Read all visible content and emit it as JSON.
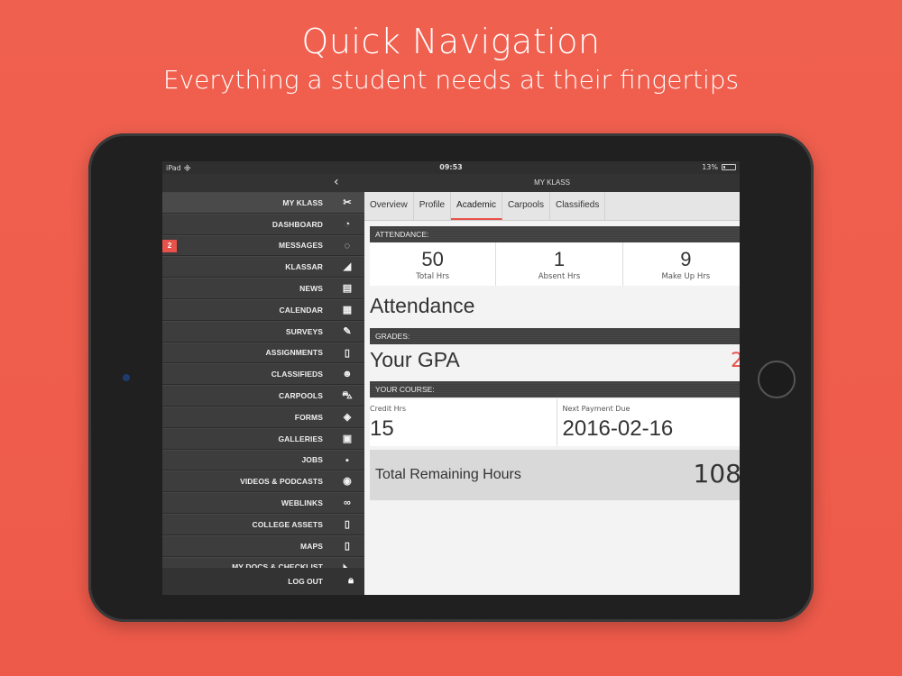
{
  "headline": {
    "title": "Quick Navigation",
    "subtitle": "Everything a student needs at their fingertips"
  },
  "status_bar": {
    "device": "iPad",
    "time": "09:53",
    "battery": "13%"
  },
  "screen_title": "MY KLASS",
  "sidebar": {
    "items": [
      {
        "label": "MY KLASS",
        "icon": "tools-icon"
      },
      {
        "label": "DASHBOARD",
        "icon": "gauge-icon"
      },
      {
        "label": "MESSAGES",
        "icon": "chat-icon",
        "badge": "2"
      },
      {
        "label": "KlassAR",
        "icon": "ar-icon"
      },
      {
        "label": "NEWS",
        "icon": "newspaper-icon"
      },
      {
        "label": "CALENDAR",
        "icon": "calendar-icon"
      },
      {
        "label": "SURVEYS",
        "icon": "pencil-icon"
      },
      {
        "label": "ASSIGNMENTS",
        "icon": "document-icon"
      },
      {
        "label": "CLASSIFIEDS",
        "icon": "people-icon"
      },
      {
        "label": "CARPOOLS",
        "icon": "car-icon"
      },
      {
        "label": "FORMS",
        "icon": "layers-icon"
      },
      {
        "label": "GALLERIES",
        "icon": "gallery-icon"
      },
      {
        "label": "JOBS",
        "icon": "briefcase-icon"
      },
      {
        "label": "VIDEOS & PODCASTS",
        "icon": "play-icon"
      },
      {
        "label": "WEBLINKS",
        "icon": "link-icon"
      },
      {
        "label": "COLLEGE ASSETS",
        "icon": "file-icon"
      },
      {
        "label": "MAPS",
        "icon": "map-icon"
      },
      {
        "label": "MY DOCS & CHECKLIST",
        "icon": "doc-check-icon"
      }
    ],
    "logout_label": "LOG OUT"
  },
  "tabs": [
    "Overview",
    "Profile",
    "Academic",
    "Carpools",
    "Classifieds"
  ],
  "active_tab": "Academic",
  "attendance": {
    "section_label": "ATTENDANCE:",
    "stats": [
      {
        "value": "50",
        "label": "Total Hrs"
      },
      {
        "value": "1",
        "label": "Absent Hrs"
      },
      {
        "value": "9",
        "label": "Make Up Hrs"
      }
    ],
    "heading": "Attendance"
  },
  "grades": {
    "section_label": "GRADES:",
    "heading": "Your GPA",
    "value": "2"
  },
  "course": {
    "section_label": "YOUR COURSE:",
    "credit_label": "Credit Hrs",
    "credit_value": "15",
    "payment_label": "Next Payment Due",
    "payment_value": "2016-02-16",
    "remaining_label": "Total Remaining Hours",
    "remaining_value": "108"
  },
  "colors": {
    "background": "#ef5e4e",
    "accent": "#e8524a"
  }
}
